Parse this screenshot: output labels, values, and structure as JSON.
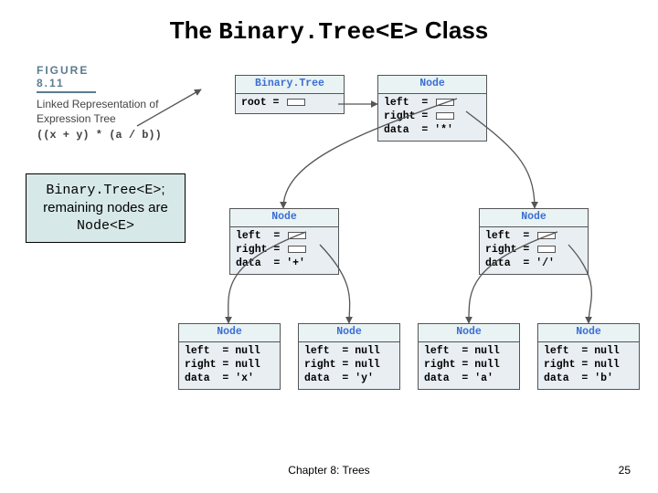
{
  "title": {
    "pre": "The ",
    "code": "Binary.Tree<E>",
    "post": " Class"
  },
  "figure": {
    "num": "FIGURE 8.11",
    "caption": "Linked Representation of Expression Tree",
    "expr": "((x + y) * (a / b))"
  },
  "annot": {
    "line1_code": "Binary.Tree<E>",
    "line1_post": ";",
    "line2": "remaining nodes are",
    "line3_code": "Node<E>"
  },
  "boxes": {
    "binarytree": {
      "hdr": "Binary.Tree",
      "root_label": "root ="
    },
    "node_mul": {
      "hdr": "Node",
      "left": "left  =",
      "right": "right =",
      "data": "data  = '*'"
    },
    "node_plus": {
      "hdr": "Node",
      "left": "left  =",
      "right": "right =",
      "data": "data  = '+'"
    },
    "node_div": {
      "hdr": "Node",
      "left": "left  =",
      "right": "right =",
      "data": "data  = '/'"
    },
    "leaf_x": {
      "hdr": "Node",
      "left": "left  = null",
      "right": "right = null",
      "data": "data  = 'x'"
    },
    "leaf_y": {
      "hdr": "Node",
      "left": "left  = null",
      "right": "right = null",
      "data": "data  = 'y'"
    },
    "leaf_a": {
      "hdr": "Node",
      "left": "left  = null",
      "right": "right = null",
      "data": "data  = 'a'"
    },
    "leaf_b": {
      "hdr": "Node",
      "left": "left  = null",
      "right": "right = null",
      "data": "data  = 'b'"
    }
  },
  "footer": {
    "center": "Chapter 8: Trees",
    "page": "25"
  }
}
